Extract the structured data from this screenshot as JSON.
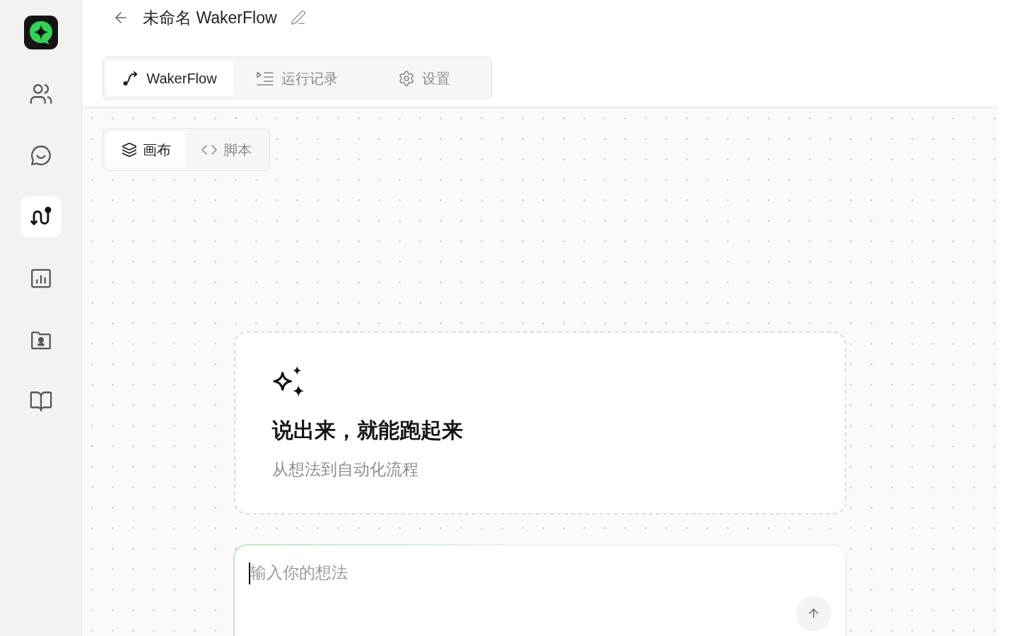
{
  "sidebar": {
    "items": [
      {
        "selected": false
      },
      {
        "selected": false
      },
      {
        "selected": true
      },
      {
        "selected": false
      },
      {
        "selected": false
      },
      {
        "selected": false
      }
    ]
  },
  "header": {
    "title": "未命名 WakerFlow"
  },
  "tabs": [
    {
      "label": "WakerFlow",
      "selected": true
    },
    {
      "label": "运行记录",
      "selected": false
    },
    {
      "label": "设置",
      "selected": false
    }
  ],
  "canvas": {
    "view_tabs": [
      {
        "label": "画布",
        "selected": true
      },
      {
        "label": "脚本",
        "selected": false
      }
    ],
    "empty_state": {
      "heading": "说出来，就能跑起来",
      "subtitle": "从想法到自动化流程"
    },
    "prompt": {
      "placeholder": "输入你的想法"
    }
  }
}
